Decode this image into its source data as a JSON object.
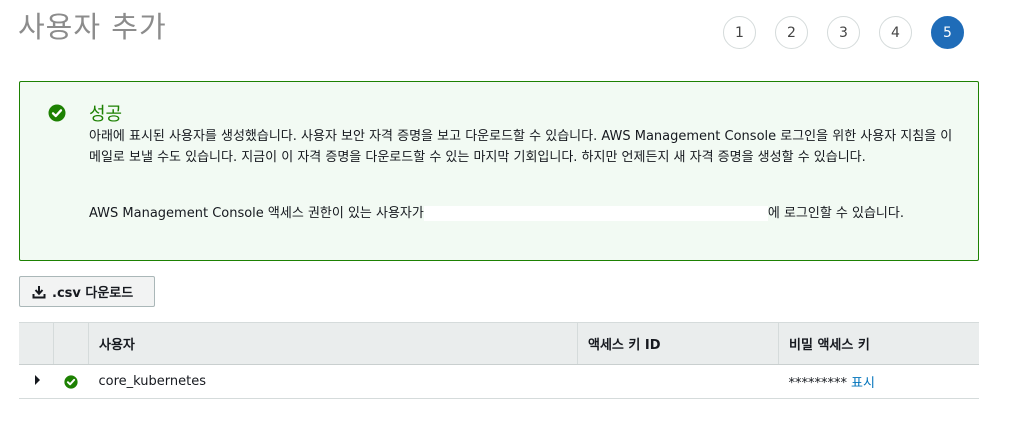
{
  "page": {
    "title": "사용자 추가"
  },
  "steps": [
    "1",
    "2",
    "3",
    "4",
    "5"
  ],
  "alert": {
    "title": "성공",
    "body": "아래에 표시된 사용자를 생성했습니다. 사용자 보안 자격 증명을 보고 다운로드할 수 있습니다. AWS Management Console 로그인을 위한 사용자 지침을 이메일로 보낼 수도 있습니다. 지금이 이 자격 증명을 다운로드할 수 있는 마지막 기회입니다. 하지만 언제든지 새 자격 증명을 생성할 수 있습니다.",
    "console_prefix": "AWS Management Console 액세스 권한이 있는 사용자가",
    "console_suffix": "에 로그인할 수 있습니다.",
    "color": "#1d8102"
  },
  "actions": {
    "csv_download": ".csv 다운로드"
  },
  "table": {
    "headers": {
      "user": "사용자",
      "access_key_id": "액세스 키 ID",
      "secret_key": "비밀 액세스 키"
    },
    "rows": [
      {
        "user": "core_kubernetes",
        "access_key_id": "",
        "secret_masked": "*********",
        "show_label": "표시"
      }
    ]
  },
  "colors": {
    "accent": "#1f6cb8",
    "success": "#1d8102",
    "link": "#0073bb"
  }
}
